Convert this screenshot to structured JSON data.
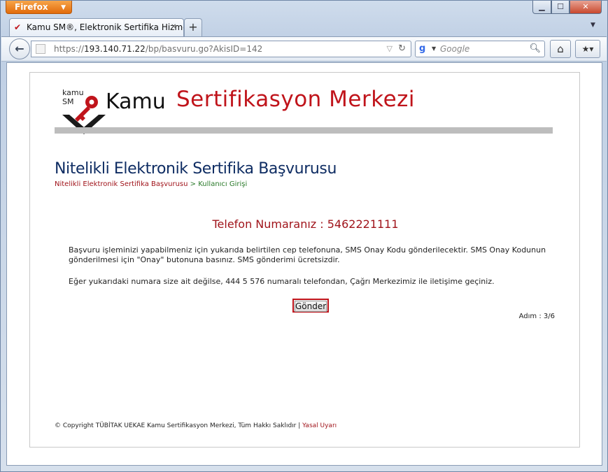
{
  "browser": {
    "menu_label": "Firefox",
    "tab_title": "Kamu SM®, Elektronik Sertifika Hizmetl...",
    "url_prefix": "https://",
    "url_host": "193.140.71.22",
    "url_path": "/bp/basvuru.go?AkisID=142",
    "search_placeholder": "Google"
  },
  "logo": {
    "small_line1": "kamu",
    "small_line2": "SM",
    "word_black": "Kamu",
    "word_red": "Sertifikasyon Merkezi"
  },
  "page": {
    "title": "Nitelikli Elektronik Sertifika Başvurusu",
    "breadcrumb": {
      "first": "Nitelikli Elektronik Sertifika Başvurusu",
      "separator": ">",
      "second": "Kullanıcı Girişi"
    },
    "phone_line": "Telefon Numaranız : 5462221111",
    "paragraph1": "Başvuru işleminizi yapabilmeniz için yukarıda belirtilen cep telefonuna, SMS Onay Kodu gönderilecektir. SMS Onay Kodunun gönderilmesi için \"Onay\" butonuna basınız. SMS gönderimi ücretsizdir.",
    "paragraph2": "Eğer yukarıdaki numara size ait değilse, 444 5 576 numaralı telefondan, Çağrı Merkezimiz ile iletişime geçiniz.",
    "send_button": "Gönder",
    "step": "Adım : 3/6"
  },
  "footer": {
    "copyright": "© Copyright",
    "org": "TÜBİTAK UEKAE Kamu Sertifikasyon Merkezi, Tüm Hakkı Saklıdır",
    "separator": "|",
    "legal_link": "Yasal Uyarı"
  },
  "colors": {
    "brand_red": "#c0141b",
    "title_blue": "#0f2d63",
    "breadcrumb_green": "#2a7a2a"
  }
}
